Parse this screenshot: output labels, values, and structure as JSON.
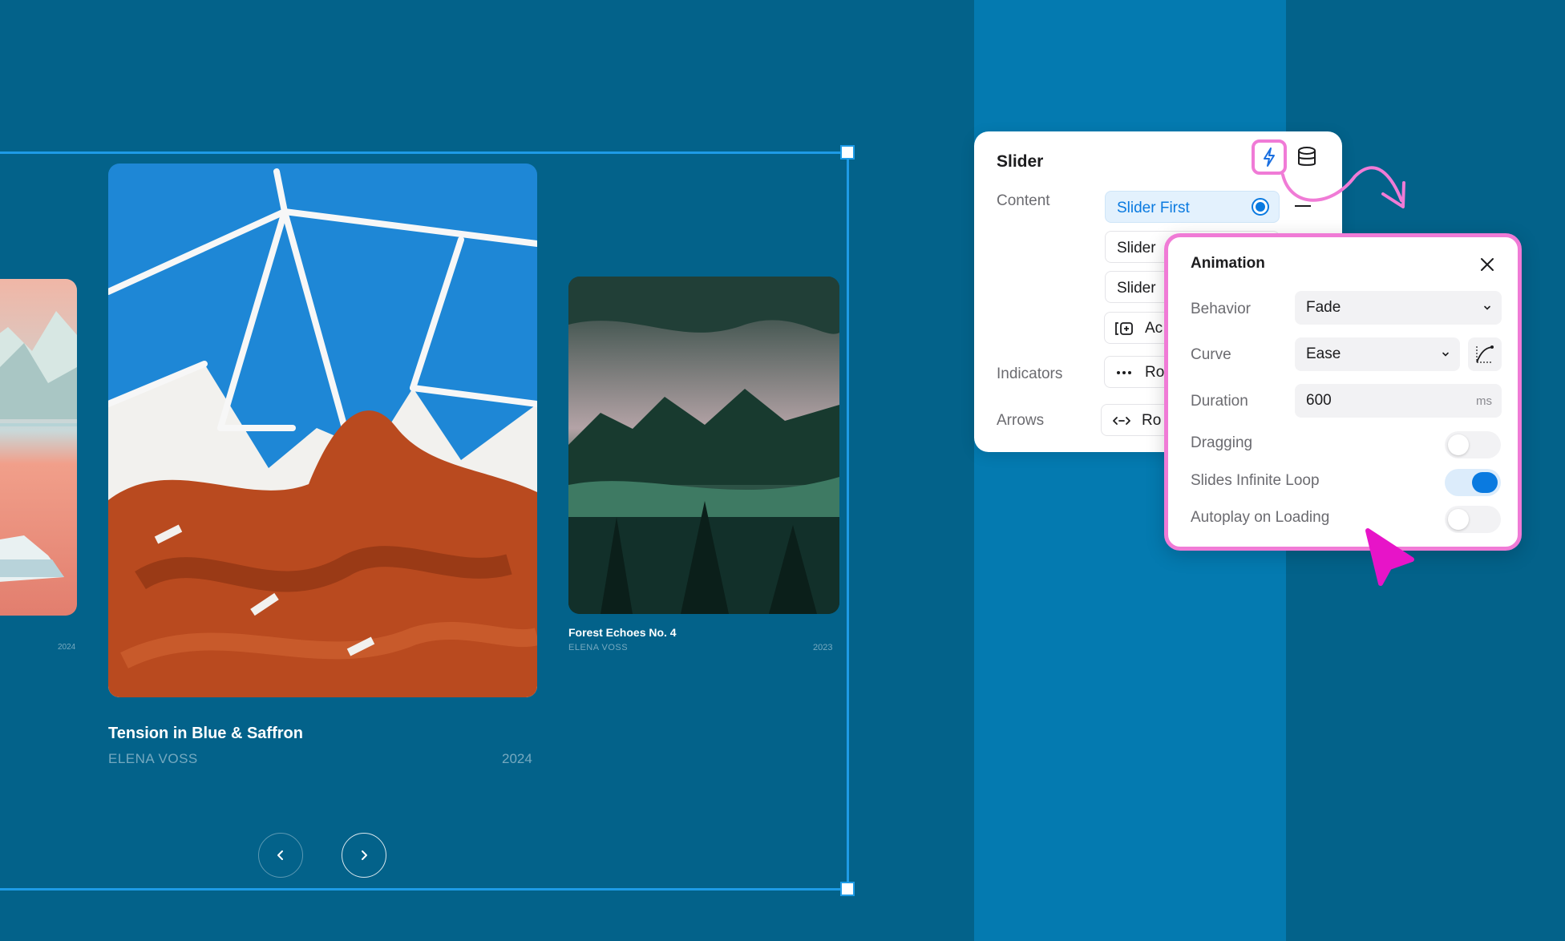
{
  "colors": {
    "canvas_bg": "#03628a",
    "panel_band": "#047ab0",
    "selection": "#1e9be6",
    "highlight_pink": "#f07bd6",
    "accent_blue": "#0a7ae0",
    "cursor_magenta": "#e714c8"
  },
  "slides": {
    "left_partial": {
      "year": "2024"
    },
    "main": {
      "title": "Tension in Blue & Saffron",
      "artist": "ELENA VOSS",
      "year": "2024"
    },
    "right": {
      "title": "Forest Echoes No. 4",
      "artist": "ELENA VOSS",
      "year": "2023"
    }
  },
  "nav": {
    "prev_icon": "chevron-left-icon",
    "next_icon": "chevron-right-icon"
  },
  "slider_panel": {
    "title": "Slider",
    "icons": [
      "bolt-icon",
      "database-icon"
    ],
    "content_label": "Content",
    "content_items": [
      "Slider First",
      "Slider",
      "Slider"
    ],
    "add_label": "Ac",
    "indicators_label": "Indicators",
    "indicators_value": "Ro",
    "arrows_label": "Arrows",
    "arrows_value": "Ro"
  },
  "animation": {
    "title": "Animation",
    "behavior_label": "Behavior",
    "behavior_value": "Fade",
    "curve_label": "Curve",
    "curve_value": "Ease",
    "duration_label": "Duration",
    "duration_value": "600",
    "duration_unit": "ms",
    "dragging_label": "Dragging",
    "dragging_on": false,
    "loop_label": "Slides Infinite Loop",
    "loop_on": true,
    "autoplay_label": "Autoplay on Loading",
    "autoplay_on": false
  }
}
